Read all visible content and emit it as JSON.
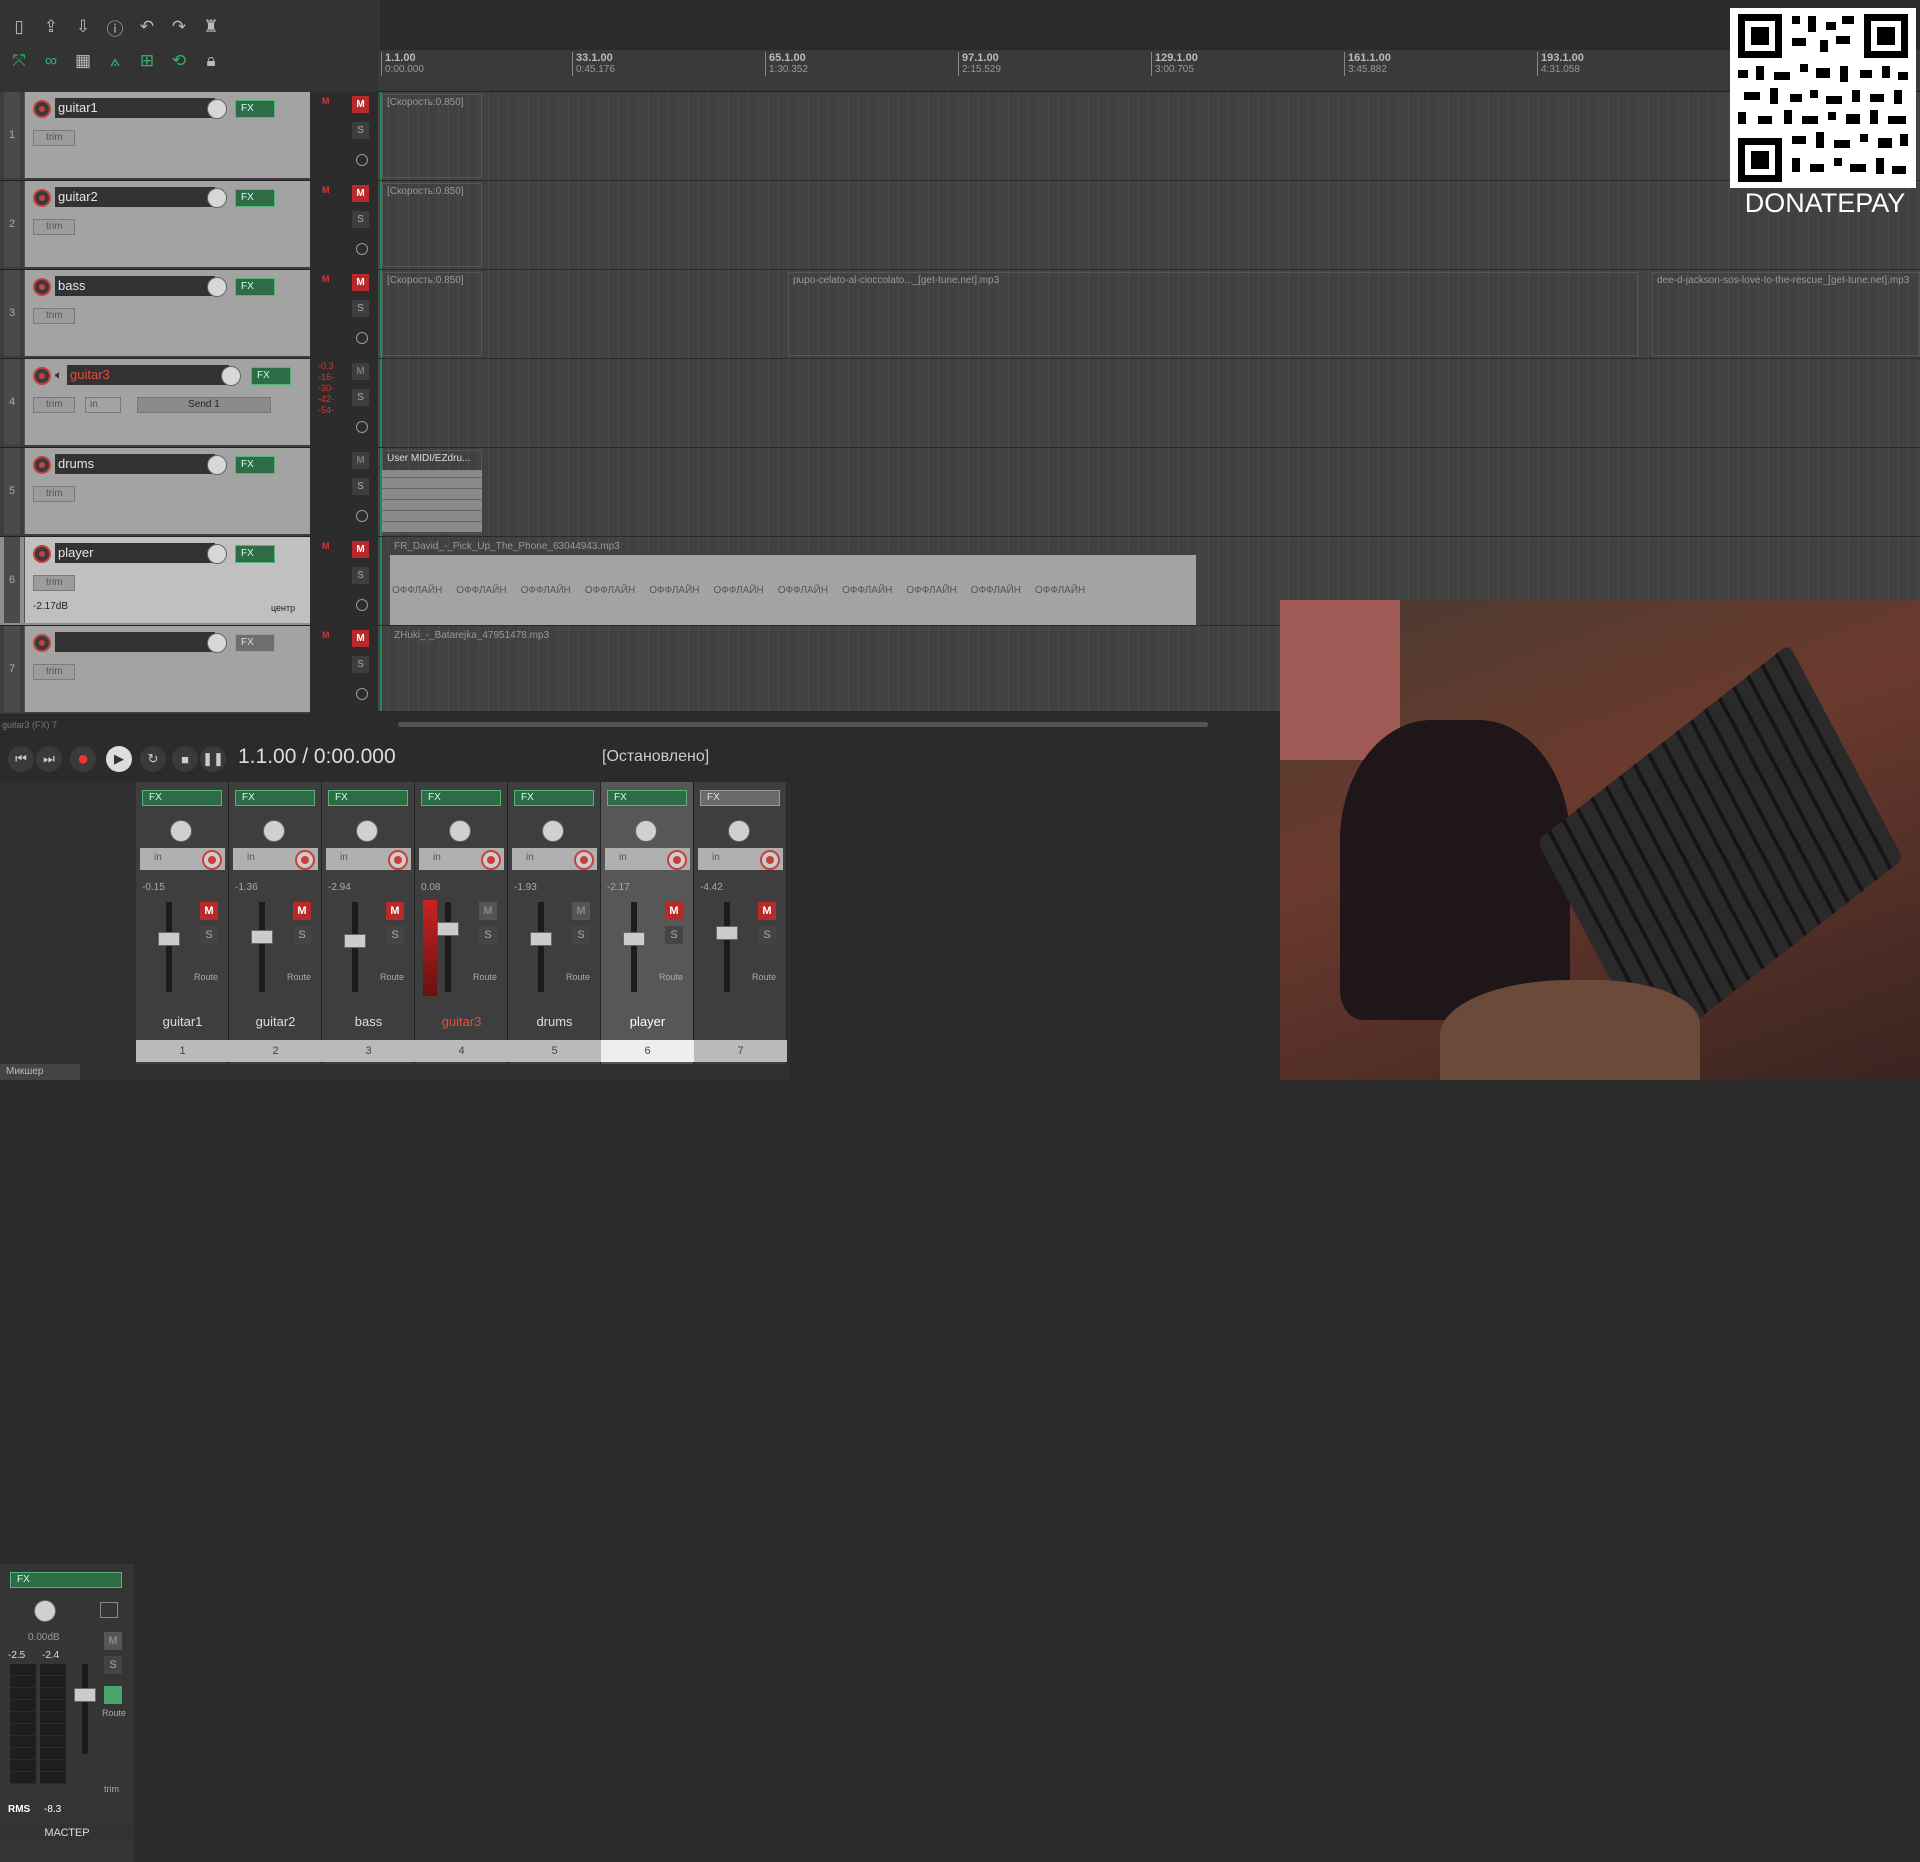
{
  "toolbar": {
    "icons_row1": [
      "new-project-icon",
      "open-project-icon",
      "save-project-icon",
      "project-settings-icon",
      "undo-icon",
      "redo-icon",
      "metronome-icon"
    ],
    "icons_row2": [
      "ripple-edit-icon",
      "item-grouping-icon",
      "snap-grid-icon",
      "auto-crossfade-icon",
      "envelope-points-icon",
      "loop-icon",
      "lock-icon"
    ]
  },
  "ruler": {
    "marks": [
      {
        "bar": "1.1.00",
        "time": "0:00.000"
      },
      {
        "bar": "33.1.00",
        "time": "0:45.176"
      },
      {
        "bar": "65.1.00",
        "time": "1:30.352"
      },
      {
        "bar": "97.1.00",
        "time": "2:15.529"
      },
      {
        "bar": "129.1.00",
        "time": "3:00.705"
      },
      {
        "bar": "161.1.00",
        "time": "3:45.882"
      },
      {
        "bar": "193.1.00",
        "time": "4:31.058"
      }
    ]
  },
  "tracks": [
    {
      "num": "1",
      "name": "guitar1",
      "trim": "trim",
      "fx": "FX",
      "mute": "M",
      "solo": "S",
      "name_color": "white",
      "fx_on": true,
      "muted": true
    },
    {
      "num": "2",
      "name": "guitar2",
      "trim": "trim",
      "fx": "FX",
      "mute": "M",
      "solo": "S",
      "name_color": "white",
      "fx_on": true,
      "muted": true
    },
    {
      "num": "3",
      "name": "bass",
      "trim": "trim",
      "fx": "FX",
      "mute": "M",
      "solo": "S",
      "name_color": "white",
      "fx_on": true,
      "muted": true
    },
    {
      "num": "4",
      "name": "guitar3",
      "trim": "trim",
      "fx": "FX",
      "mute": "M",
      "solo": "S",
      "name_color": "red",
      "fx_on": true,
      "muted": false,
      "send": "Send 1",
      "in": "in",
      "meter_vals": [
        "-0.3",
        "-16-",
        "-30-",
        "-42-",
        "-54-"
      ]
    },
    {
      "num": "5",
      "name": "drums",
      "trim": "trim",
      "fx": "FX",
      "mute": "M",
      "solo": "S",
      "name_color": "white",
      "fx_on": true,
      "muted": false
    },
    {
      "num": "6",
      "name": "player",
      "trim": "trim",
      "fx": "FX",
      "mute": "M",
      "solo": "S",
      "name_color": "white",
      "fx_on": true,
      "muted": true,
      "vol": "-2.17dB",
      "pan": "центр",
      "selected": true
    },
    {
      "num": "7",
      "name": "",
      "trim": "trim",
      "fx": "FX",
      "mute": "M",
      "solo": "S",
      "name_color": "white",
      "fx_on": false,
      "muted": true
    }
  ],
  "clips": {
    "c1": "[Скорость:0.850]",
    "c2": "[Скорость:0.850]",
    "c3": "[Скорость:0.850]",
    "c3b": "pupo-celato-al-cioccolato..._[get-tune.net].mp3",
    "c3c": "dee-d-jackson-sos-love-to-the-rescue_[get-tune.net].mp3",
    "c5": "User MIDI/EZdru...",
    "c6": "FR_David_-_Pick_Up_The_Phone_63044943.mp3",
    "c6_offline": "ОФФЛАЙН",
    "c7": "ZHuki_-_Batarejka_47951478.mp3"
  },
  "arrange_footer": "guitar3 (FX) 7",
  "transport": {
    "position": "1.1.00 / 0:00.000",
    "status": "[Остановлено]"
  },
  "master": {
    "label": "МАСТЕР",
    "vol": "0.00dB",
    "peak_l": "-2.5",
    "peak_r": "-2.4",
    "rms_label": "RMS",
    "rms_val": "-8.3",
    "route": "Route",
    "trim": "trim",
    "fx": "FX"
  },
  "mixer": {
    "strips": [
      {
        "name": "guitar1",
        "num": "1",
        "vol": "-0.15",
        "fx": "FX",
        "in": "in",
        "m": "M",
        "s": "S",
        "route": "Route",
        "muted": true
      },
      {
        "name": "guitar2",
        "num": "2",
        "vol": "-1.36",
        "fx": "FX",
        "in": "in",
        "m": "M",
        "s": "S",
        "route": "Route",
        "muted": true
      },
      {
        "name": "bass",
        "num": "3",
        "vol": "-2.94",
        "fx": "FX",
        "in": "in",
        "m": "M",
        "s": "S",
        "route": "Route",
        "muted": true
      },
      {
        "name": "guitar3",
        "num": "4",
        "vol": "0.08",
        "fx": "FX",
        "in": "in",
        "m": "M",
        "s": "S",
        "route": "Route",
        "muted": false,
        "red": true
      },
      {
        "name": "drums",
        "num": "5",
        "vol": "-1.93",
        "fx": "FX",
        "in": "in",
        "m": "M",
        "s": "S",
        "route": "Route",
        "muted": false
      },
      {
        "name": "player",
        "num": "6",
        "vol": "-2.17",
        "fx": "FX",
        "in": "in",
        "m": "M",
        "s": "S",
        "route": "Route",
        "muted": true,
        "sel": true
      },
      {
        "name": "",
        "num": "7",
        "vol": "-4.42",
        "fx": "FX",
        "in": "in",
        "m": "M",
        "s": "S",
        "route": "Route",
        "muted": true
      }
    ]
  },
  "bottom_tab": "Микшер",
  "overlay": {
    "donate_text": "DONATEPAY"
  },
  "colors": {
    "accent_green": "#53b578",
    "mute_red": "#b82a2a",
    "arm_red": "#c8403c"
  }
}
